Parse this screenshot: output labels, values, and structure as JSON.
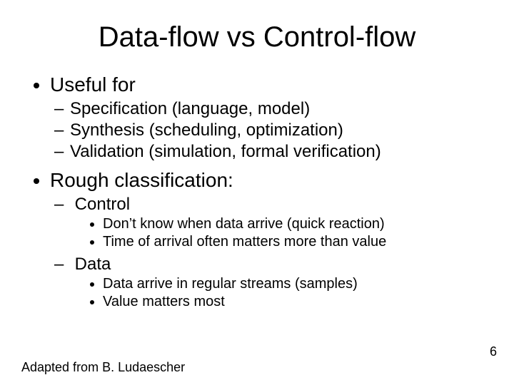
{
  "title": "Data-flow vs Control-flow",
  "bullets": {
    "useful_for": {
      "label": "Useful for",
      "items": [
        "Specification (language, model)",
        "Synthesis (scheduling, optimization)",
        "Validation (simulation, formal verification)"
      ]
    },
    "rough_classification": {
      "label": "Rough classification:",
      "control": {
        "label": "Control",
        "items": [
          "Don’t know when data arrive (quick reaction)",
          "Time of arrival often matters more than value"
        ]
      },
      "data": {
        "label": "Data",
        "items": [
          "Data arrive in regular streams (samples)",
          "Value matters most"
        ]
      }
    }
  },
  "page_number": "6",
  "footer": "Adapted from B. Ludaescher"
}
